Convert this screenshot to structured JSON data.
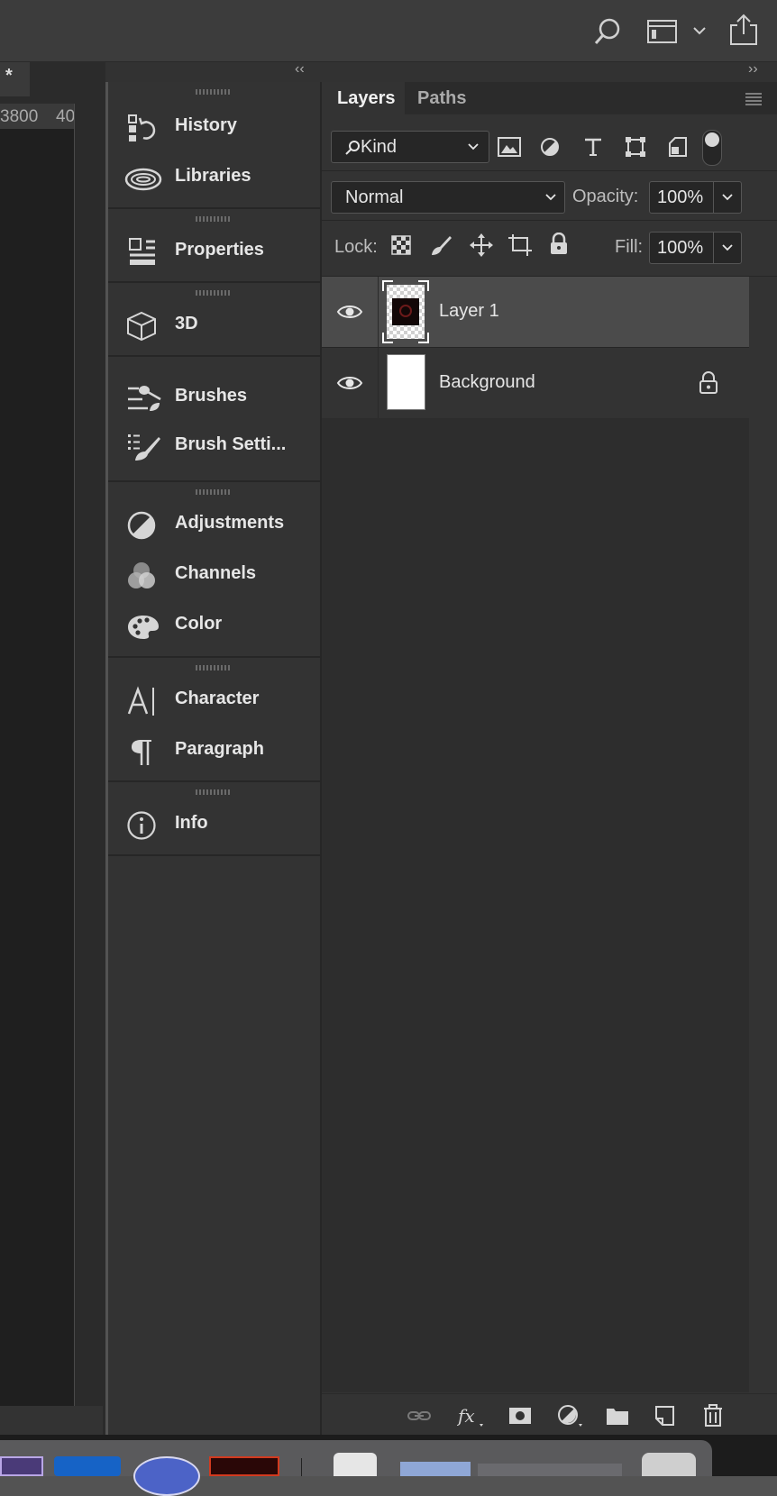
{
  "document_tab": {
    "title": "*"
  },
  "ruler": {
    "ticks": [
      "3800",
      "40"
    ]
  },
  "collapse_left_glyph": "‹‹",
  "collapse_right_glyph": "››",
  "panel_groups": [
    {
      "items": [
        {
          "label": "History",
          "icon": "history-icon"
        },
        {
          "label": "Libraries",
          "icon": "libraries-icon"
        }
      ]
    },
    {
      "items": [
        {
          "label": "Properties",
          "icon": "properties-icon"
        }
      ]
    },
    {
      "items": [
        {
          "label": "3D",
          "icon": "cube-icon"
        }
      ]
    },
    {
      "items": [
        {
          "label": "Brushes",
          "icon": "brushes-icon"
        },
        {
          "label": "Brush Setti...",
          "icon": "brush-settings-icon"
        }
      ]
    },
    {
      "items": [
        {
          "label": "Adjustments",
          "icon": "adjustments-icon"
        },
        {
          "label": "Channels",
          "icon": "channels-icon"
        },
        {
          "label": "Color",
          "icon": "palette-icon"
        }
      ]
    },
    {
      "items": [
        {
          "label": "Character",
          "icon": "character-icon"
        },
        {
          "label": "Paragraph",
          "icon": "paragraph-icon"
        }
      ]
    },
    {
      "items": [
        {
          "label": "Info",
          "icon": "info-icon"
        }
      ]
    }
  ],
  "layers_panel": {
    "tabs": [
      "Layers",
      "Paths"
    ],
    "filter": {
      "value": "Kind"
    },
    "blend_mode": {
      "value": "Normal"
    },
    "opacity": {
      "label": "Opacity:",
      "value": "100%"
    },
    "lock": {
      "label": "Lock:"
    },
    "fill": {
      "label": "Fill:",
      "value": "100%"
    },
    "layers": [
      {
        "name": "Layer 1",
        "selected": true,
        "visible": true
      },
      {
        "name": "Background",
        "selected": false,
        "visible": true,
        "locked": true
      }
    ]
  },
  "colors": {
    "panel_bg": "#333333",
    "selected_layer_bg": "#4b4b4b",
    "canvas_bg": "#1f1f1f",
    "text": "#e6e6e6"
  }
}
